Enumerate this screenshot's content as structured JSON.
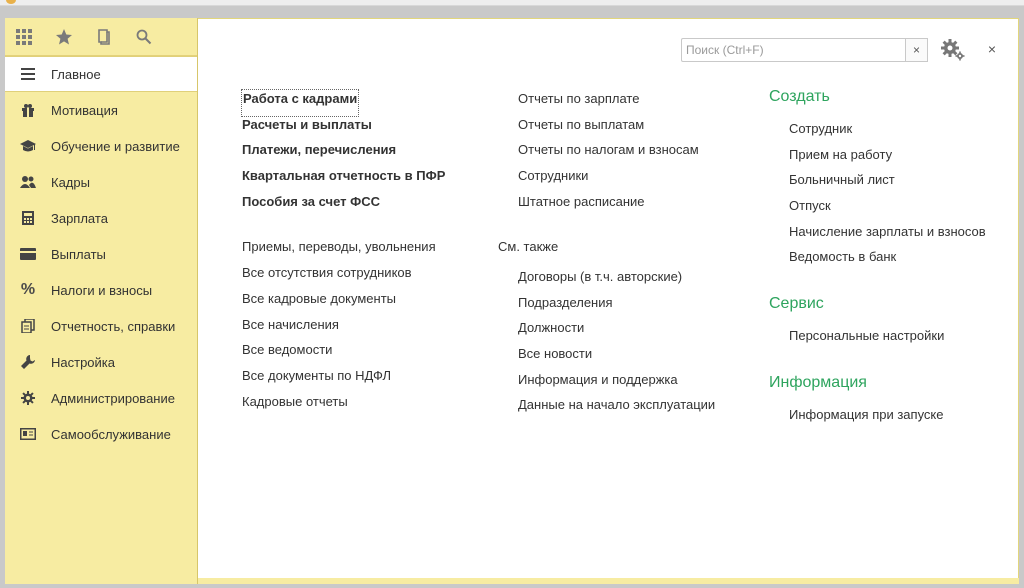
{
  "colors": {
    "accent_green": "#2ea45e",
    "sidebar_bg": "#f7eca2"
  },
  "toolbar": {
    "icons": [
      "apps-grid-icon",
      "favorites-star-icon",
      "history-icon",
      "search-icon"
    ]
  },
  "sidebar": {
    "items": [
      {
        "label": "Главное",
        "icon": "menu-lines-icon",
        "active": true
      },
      {
        "label": "Мотивация",
        "icon": "gift-icon"
      },
      {
        "label": "Обучение и развитие",
        "icon": "graduation-cap-icon"
      },
      {
        "label": "Кадры",
        "icon": "people-icon"
      },
      {
        "label": "Зарплата",
        "icon": "calculator-icon"
      },
      {
        "label": "Выплаты",
        "icon": "card-icon"
      },
      {
        "label": "Налоги и взносы",
        "icon": "percent-icon"
      },
      {
        "label": "Отчетность, справки",
        "icon": "documents-icon"
      },
      {
        "label": "Настройка",
        "icon": "wrench-icon"
      },
      {
        "label": "Администрирование",
        "icon": "gear-icon"
      },
      {
        "label": "Самообслуживание",
        "icon": "id-card-icon"
      }
    ]
  },
  "search": {
    "placeholder": "Поиск (Ctrl+F)",
    "value": "",
    "clear": "×"
  },
  "close_label": "×",
  "col1": {
    "bold": [
      "Работа с кадрами",
      "Расчеты и выплаты",
      "Платежи, перечисления",
      "Квартальная отчетность в ПФР",
      "Пособия за счет ФСС"
    ],
    "links": [
      "Приемы, переводы, увольнения",
      "Все отсутствия сотрудников",
      "Все кадровые документы",
      "Все начисления",
      "Все ведомости",
      "Все документы по НДФЛ",
      "Кадровые отчеты"
    ]
  },
  "col2": {
    "reports": [
      "Отчеты по зарплате",
      "Отчеты по выплатам",
      "Отчеты по налогам и взносам",
      "Сотрудники",
      "Штатное расписание"
    ],
    "see_also_label": "См. также",
    "see_also": [
      "Договоры (в т.ч. авторские)",
      "Подразделения",
      "Должности",
      "Все новости",
      "Информация и поддержка",
      "Данные на начало эксплуатации"
    ]
  },
  "col3": {
    "create_title": "Создать",
    "create": [
      "Сотрудник",
      "Прием на работу",
      "Больничный лист",
      "Отпуск",
      "Начисление зарплаты и взносов",
      "Ведомость в банк"
    ],
    "service_title": "Сервис",
    "service": [
      "Персональные настройки"
    ],
    "info_title": "Информация",
    "info": [
      "Информация при запуске"
    ]
  }
}
